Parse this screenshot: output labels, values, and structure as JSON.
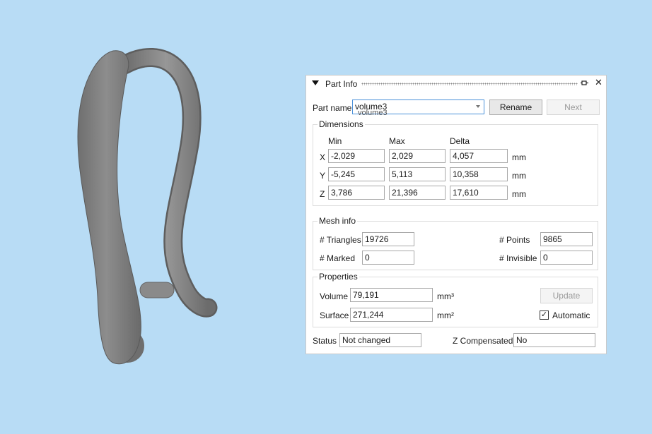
{
  "panel": {
    "title": "Part Info",
    "icons": {
      "collapse": "triangle-down-icon",
      "pin": "pin-icon",
      "close": "close-icon"
    },
    "close_glyph": "✕"
  },
  "part": {
    "label": "Part name",
    "value": "volume3",
    "ghost_value": "volume3",
    "rename_label": "Rename",
    "next_label": "Next"
  },
  "dimensions": {
    "title": "Dimensions",
    "headers": {
      "min": "Min",
      "max": "Max",
      "delta": "Delta"
    },
    "unit": "mm",
    "rows": [
      {
        "axis": "X",
        "min": "-2,029",
        "max": "2,029",
        "delta": "4,057"
      },
      {
        "axis": "Y",
        "min": "-5,245",
        "max": "5,113",
        "delta": "10,358"
      },
      {
        "axis": "Z",
        "min": "3,786",
        "max": "21,396",
        "delta": "17,610"
      }
    ]
  },
  "mesh": {
    "title": "Mesh info",
    "triangles_label": "# Triangles",
    "triangles": "19726",
    "points_label": "# Points",
    "points": "9865",
    "marked_label": "# Marked",
    "marked": "0",
    "invisible_label": "# Invisible",
    "invisible": "0"
  },
  "properties": {
    "title": "Properties",
    "volume_label": "Volume",
    "volume": "79,191",
    "volume_unit": "mm³",
    "surface_label": "Surface",
    "surface": "271,244",
    "surface_unit": "mm²",
    "update_label": "Update",
    "automatic_label": "Automatic",
    "automatic_checked": true,
    "check_glyph": "✓"
  },
  "status": {
    "label": "Status",
    "value": "Not changed",
    "zcomp_label": "Z Compensated",
    "zcomp_value": "No"
  },
  "colors": {
    "background": "#b8dcf5",
    "model": "#7a7a7a",
    "accent": "#4a90d9"
  }
}
